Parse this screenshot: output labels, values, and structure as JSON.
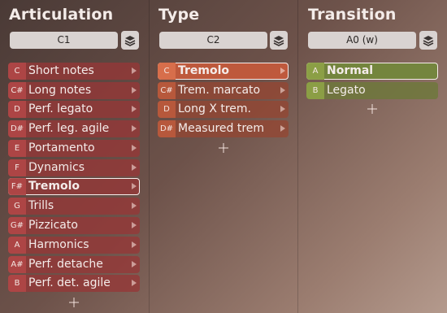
{
  "articulation": {
    "title": "Articulation",
    "key_value": "C1",
    "items": [
      {
        "key": "C",
        "label": "Short notes"
      },
      {
        "key": "C#",
        "label": "Long notes"
      },
      {
        "key": "D",
        "label": "Perf. legato"
      },
      {
        "key": "D#",
        "label": "Perf. leg. agile"
      },
      {
        "key": "E",
        "label": "Portamento"
      },
      {
        "key": "F",
        "label": "Dynamics"
      },
      {
        "key": "F#",
        "label": "Tremolo"
      },
      {
        "key": "G",
        "label": "Trills"
      },
      {
        "key": "G#",
        "label": "Pizzicato"
      },
      {
        "key": "A",
        "label": "Harmonics"
      },
      {
        "key": "A#",
        "label": "Perf. detache"
      },
      {
        "key": "B",
        "label": "Perf. det. agile"
      }
    ],
    "selected_index": 6
  },
  "type": {
    "title": "Type",
    "key_value": "C2",
    "items": [
      {
        "key": "C",
        "label": "Tremolo"
      },
      {
        "key": "C#",
        "label": "Trem. marcato"
      },
      {
        "key": "D",
        "label": "Long X trem."
      },
      {
        "key": "D#",
        "label": "Measured trem"
      }
    ],
    "selected_index": 0
  },
  "transition": {
    "title": "Transition",
    "key_value": "A0 (w)",
    "items": [
      {
        "key": "A",
        "label": "Normal"
      },
      {
        "key": "B",
        "label": "Legato"
      }
    ],
    "selected_index": 0
  },
  "icons": {
    "layers": "layers-icon",
    "add": "plus-icon",
    "arrow": "chevron-right-icon"
  }
}
